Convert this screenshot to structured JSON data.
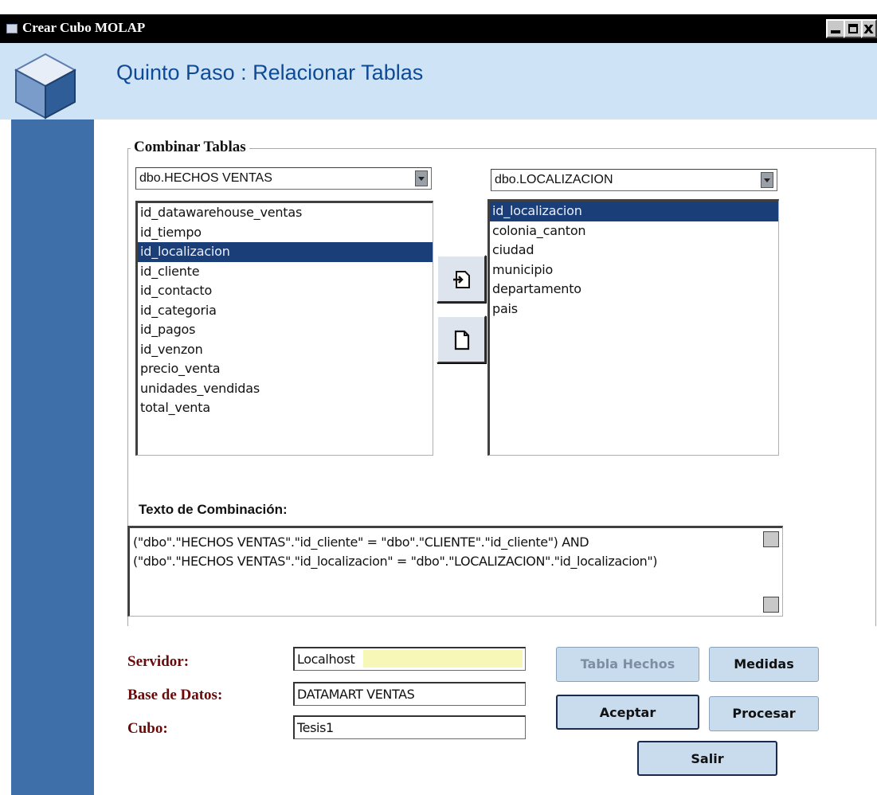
{
  "window": {
    "title": "Crear Cubo MOLAP",
    "buttons": {
      "minimize_icon": "minimize-icon",
      "maximize_icon": "maximize-icon",
      "close_glyph": "x"
    }
  },
  "header": {
    "logo_icon": "cube-icon",
    "title": "Quinto Paso : Relacionar Tablas"
  },
  "combine_group": {
    "legend": "Combinar Tablas",
    "left_table": {
      "selected": "dbo.HECHOS VENTAS",
      "fields": [
        "id_datawarehouse_ventas",
        "id_tiempo",
        "id_localizacion",
        "id_cliente",
        "id_contacto",
        "id_categoria",
        "id_pagos",
        "id_venzon",
        "precio_venta",
        "unidades_vendidas",
        "total_venta"
      ],
      "selected_field": "id_localizacion"
    },
    "right_table": {
      "selected": "dbo.LOCALIZACION",
      "fields": [
        "id_localizacion",
        "colonia_canton",
        "ciudad",
        "municipio",
        "departamento",
        "pais"
      ],
      "selected_field": "id_localizacion"
    },
    "transfer_buttons": {
      "add_icon": "add-relation-icon",
      "clear_icon": "new-document-icon"
    }
  },
  "combination_text": {
    "label": "Texto de Combinación:",
    "lines": [
      "(\"dbo\".\"HECHOS VENTAS\".\"id_cliente\" = \"dbo\".\"CLIENTE\".\"id_cliente\") AND",
      "(\"dbo\".\"HECHOS VENTAS\".\"id_localizacion\" = \"dbo\".\"LOCALIZACION\".\"id_localizacion\")"
    ]
  },
  "form": {
    "server_label": "Servidor:",
    "server_value": "Localhost",
    "database_label": "Base de Datos:",
    "database_value": "DATAMART VENTAS",
    "cube_label": "Cubo:",
    "cube_value": "Tesis1"
  },
  "actions": {
    "fact_table": "Tabla Hechos",
    "measures": "Medidas",
    "accept": "Aceptar",
    "process": "Procesar",
    "exit": "Salir"
  },
  "colors": {
    "header_bg": "#cfe3f6",
    "sidebar_bg": "#3f6fa8",
    "title_text": "#0e4b96",
    "label_text": "#6b0a0a",
    "selection": "#1a3e78",
    "button_bg": "#c9dcee"
  }
}
